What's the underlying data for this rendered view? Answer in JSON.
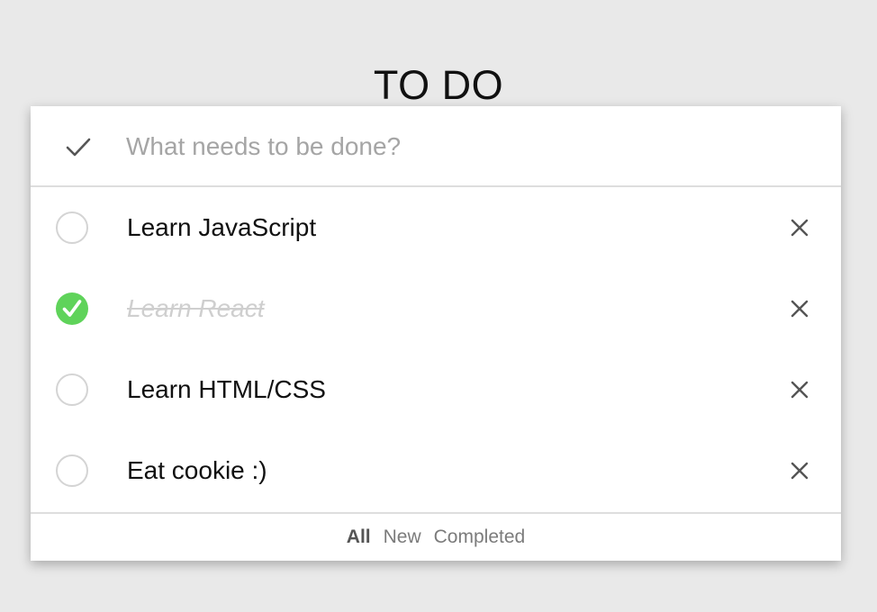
{
  "header": {
    "title": "TO DO"
  },
  "new_todo": {
    "placeholder": "What needs to be done?",
    "value": ""
  },
  "todos": [
    {
      "label": "Learn JavaScript",
      "completed": false
    },
    {
      "label": "Learn React",
      "completed": true
    },
    {
      "label": "Learn HTML/CSS",
      "completed": false
    },
    {
      "label": "Eat cookie :)",
      "completed": false
    }
  ],
  "footer": {
    "filters": [
      {
        "label": "All",
        "active": true
      },
      {
        "label": "New",
        "active": false
      },
      {
        "label": "Completed",
        "active": false
      }
    ]
  },
  "colors": {
    "background": "#e9e9e9",
    "card": "#ffffff",
    "check_green": "#5fd35a",
    "divider": "#dedede",
    "placeholder": "#a5a5a5",
    "completed_text": "#cfcfcf"
  },
  "icons": {
    "toggle_all": "checkmark-icon",
    "done": "check-circle-icon",
    "delete": "close-icon"
  }
}
